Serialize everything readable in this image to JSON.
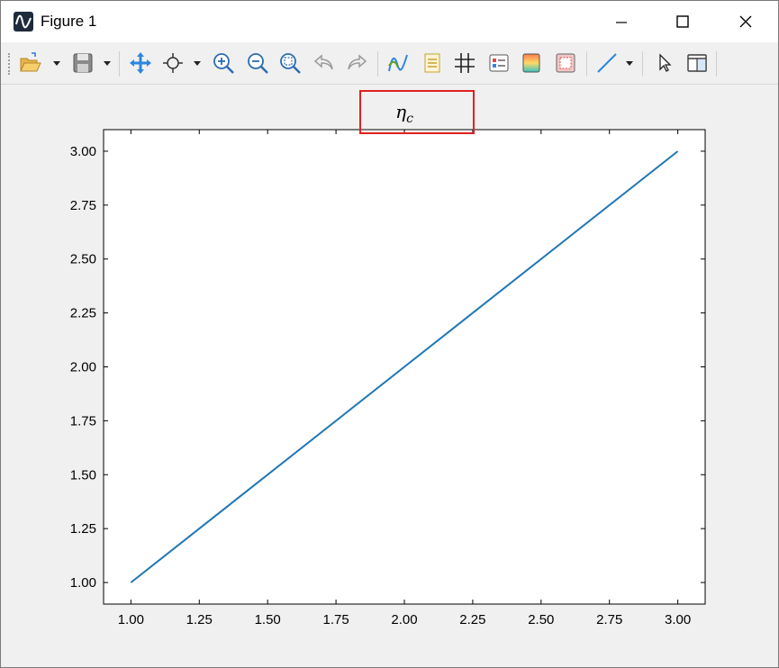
{
  "window": {
    "title": "Figure 1",
    "controls": [
      "minimize",
      "maximize",
      "close"
    ]
  },
  "toolbar": {
    "buttons": [
      {
        "name": "open-folder-icon"
      },
      {
        "name": "save-icon"
      },
      {
        "name": "pan-icon"
      },
      {
        "name": "data-cursor-icon"
      },
      {
        "name": "zoom-in-icon"
      },
      {
        "name": "zoom-out-icon"
      },
      {
        "name": "zoom-fit-icon"
      },
      {
        "name": "undo-icon"
      },
      {
        "name": "redo-icon"
      },
      {
        "name": "line-style-icon"
      },
      {
        "name": "legend-icon"
      },
      {
        "name": "grid-icon"
      },
      {
        "name": "properties-icon"
      },
      {
        "name": "colormap-icon"
      },
      {
        "name": "border-icon"
      },
      {
        "name": "line-tool-icon"
      },
      {
        "name": "select-pointer-icon"
      },
      {
        "name": "panel-toggle-icon"
      }
    ]
  },
  "chart_data": {
    "type": "line",
    "title_math": {
      "base": "η",
      "subscript": "c"
    },
    "x": [
      1.0,
      3.0
    ],
    "series": [
      {
        "values": [
          1.0,
          3.0
        ],
        "color": "#1f77b4"
      }
    ],
    "xlim": [
      0.9,
      3.1
    ],
    "ylim": [
      0.9,
      3.1
    ],
    "xticks": [
      "1.00",
      "1.25",
      "1.50",
      "1.75",
      "2.00",
      "2.25",
      "2.50",
      "2.75",
      "3.00"
    ],
    "yticks": [
      "1.00",
      "1.25",
      "1.50",
      "1.75",
      "2.00",
      "2.25",
      "2.50",
      "2.75",
      "3.00"
    ],
    "grid": false,
    "legend": false
  }
}
